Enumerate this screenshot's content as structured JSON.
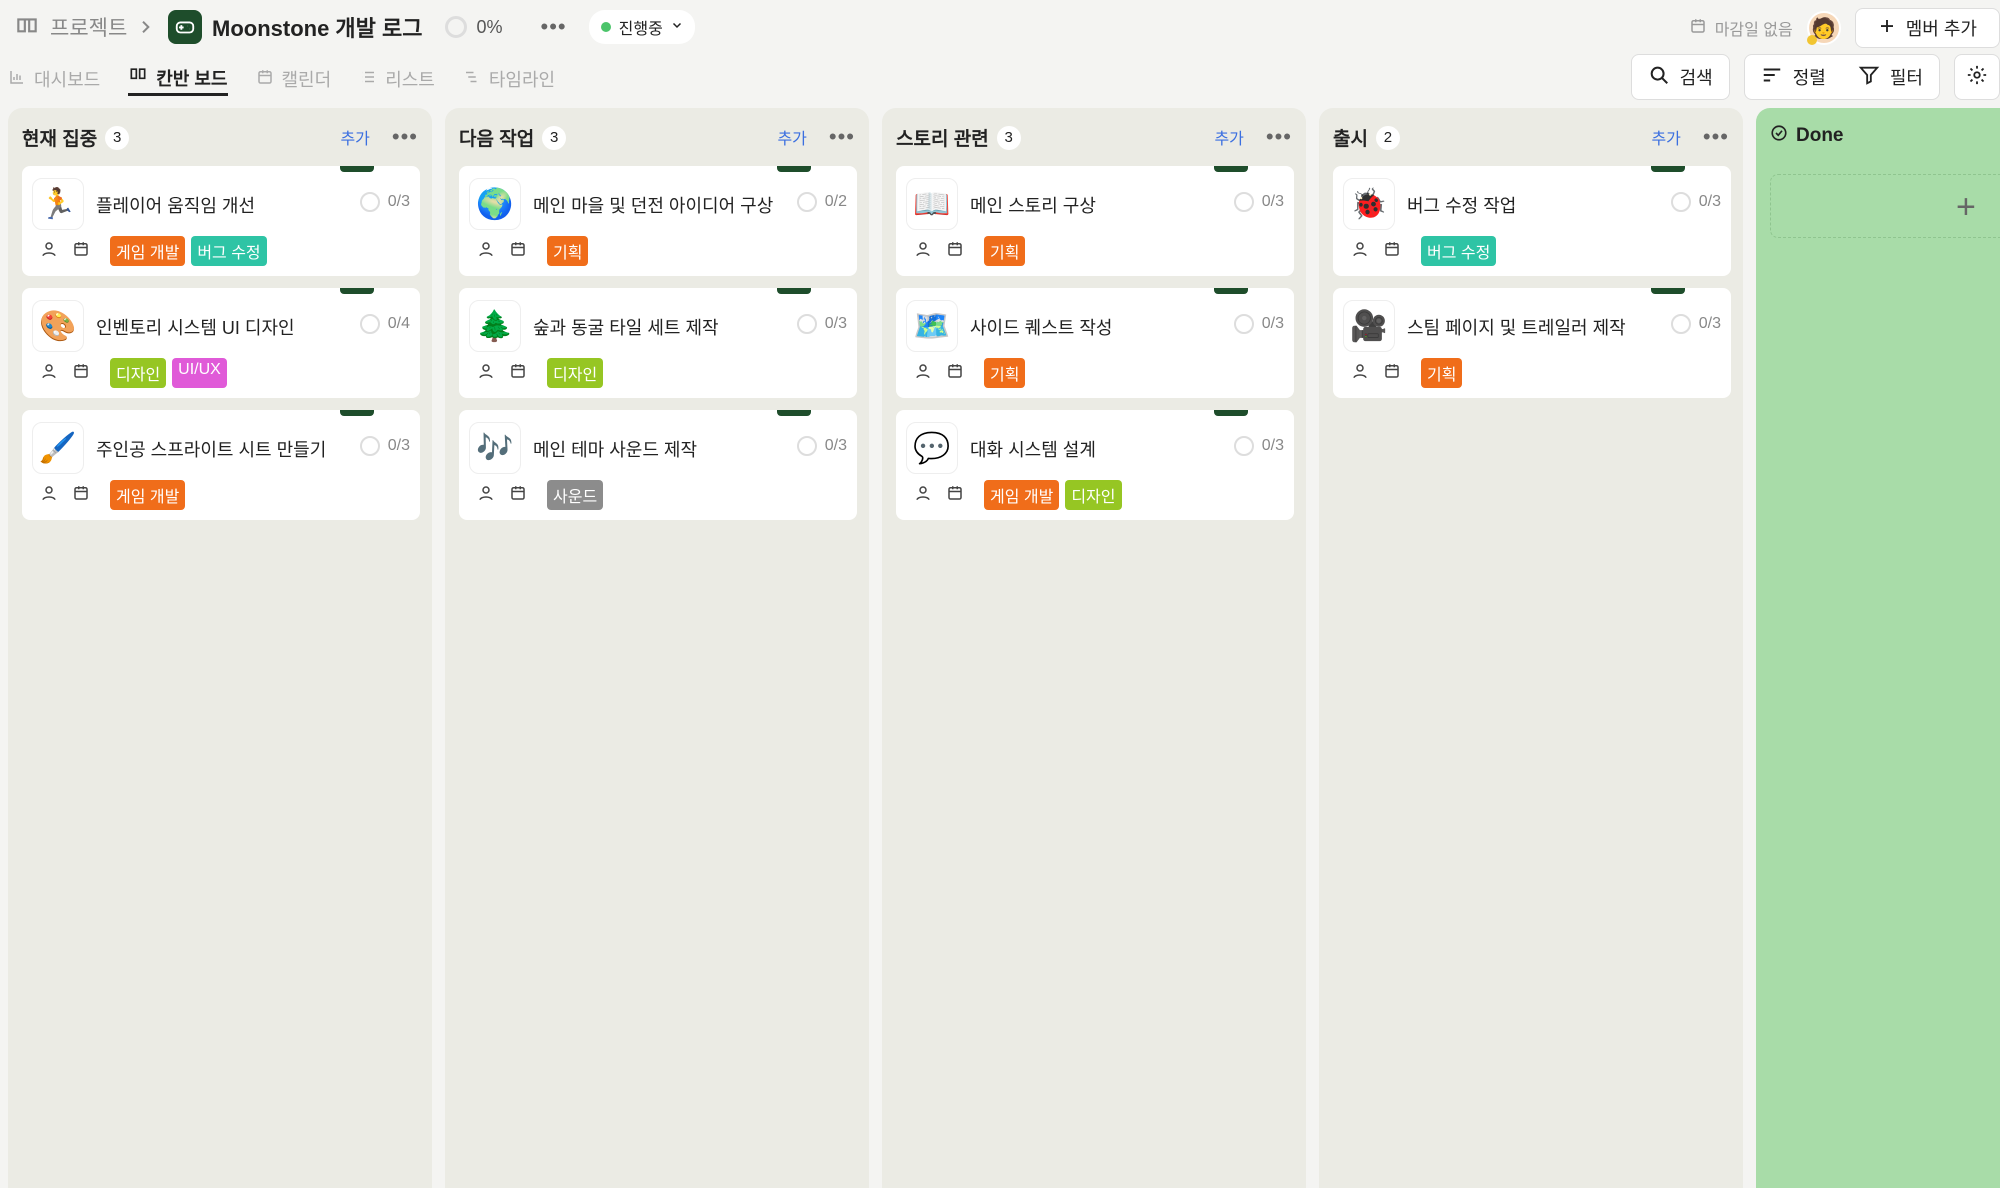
{
  "breadcrumb": {
    "root": "프로젝트"
  },
  "project": {
    "title": "Moonstone 개발 로그",
    "progress": "0%",
    "status": "진행중"
  },
  "header_right": {
    "due": "마감일 없음",
    "add_member": "멤버 추가"
  },
  "tabs": [
    {
      "label": "대시보드",
      "icon": "chart-icon"
    },
    {
      "label": "칸반 보드",
      "icon": "board-icon",
      "active": true
    },
    {
      "label": "캘린더",
      "icon": "calendar-icon"
    },
    {
      "label": "리스트",
      "icon": "list-icon"
    },
    {
      "label": "타임라인",
      "icon": "timeline-icon"
    }
  ],
  "tools": {
    "search": "검색",
    "sort": "정렬",
    "filter": "필터"
  },
  "tag_colors": {
    "게임 개발": "#f06d1a",
    "버그 수정": "#2ec4a5",
    "디자인": "#96c623",
    "UI/UX": "#e05ad8",
    "기획": "#f06d1a",
    "사운드": "#8c8c8c"
  },
  "columns": [
    {
      "title": "현재 집중",
      "count": "3",
      "add": "추가",
      "cards": [
        {
          "emoji": "🏃",
          "icon": "runner-icon",
          "name": "플레이어 움직임 개선",
          "progress": "0/3",
          "tags": [
            "게임 개발",
            "버그 수정"
          ]
        },
        {
          "emoji": "🎨",
          "icon": "palette-icon",
          "name": "인벤토리 시스템 UI 디자인",
          "progress": "0/4",
          "tags": [
            "디자인",
            "UI/UX"
          ]
        },
        {
          "emoji": "🖌️",
          "icon": "paintbrush-icon",
          "name": "주인공 스프라이트 시트 만들기",
          "progress": "0/3",
          "tags": [
            "게임 개발"
          ]
        }
      ]
    },
    {
      "title": "다음 작업",
      "count": "3",
      "add": "추가",
      "cards": [
        {
          "emoji": "🌍",
          "icon": "globe-icon",
          "name": "메인 마을 및 던전 아이디어 구상",
          "progress": "0/2",
          "tags": [
            "기획"
          ]
        },
        {
          "emoji": "🌲",
          "icon": "tree-icon",
          "name": "숲과 동굴 타일 세트 제작",
          "progress": "0/3",
          "tags": [
            "디자인"
          ]
        },
        {
          "emoji": "🎶",
          "icon": "music-icon",
          "name": "메인 테마 사운드 제작",
          "progress": "0/3",
          "tags": [
            "사운드"
          ]
        }
      ]
    },
    {
      "title": "스토리 관련",
      "count": "3",
      "add": "추가",
      "cards": [
        {
          "emoji": "📖",
          "icon": "book-icon",
          "name": "메인 스토리 구상",
          "progress": "0/3",
          "tags": [
            "기획"
          ]
        },
        {
          "emoji": "🗺️",
          "icon": "map-icon",
          "name": "사이드 퀘스트 작성",
          "progress": "0/3",
          "tags": [
            "기획"
          ]
        },
        {
          "emoji": "💬",
          "icon": "speech-bubble-icon",
          "name": "대화 시스템 설계",
          "progress": "0/3",
          "tags": [
            "게임 개발",
            "디자인"
          ]
        }
      ]
    },
    {
      "title": "출시",
      "count": "2",
      "add": "추가",
      "cards": [
        {
          "emoji": "🐞",
          "icon": "ladybug-icon",
          "name": "버그 수정 작업",
          "progress": "0/3",
          "tags": [
            "버그 수정"
          ]
        },
        {
          "emoji": "🎥",
          "icon": "camera-icon",
          "name": "스팀 페이지 및 트레일러 제작",
          "progress": "0/3",
          "tags": [
            "기획"
          ]
        }
      ]
    }
  ],
  "done_column": {
    "title": "Done"
  }
}
